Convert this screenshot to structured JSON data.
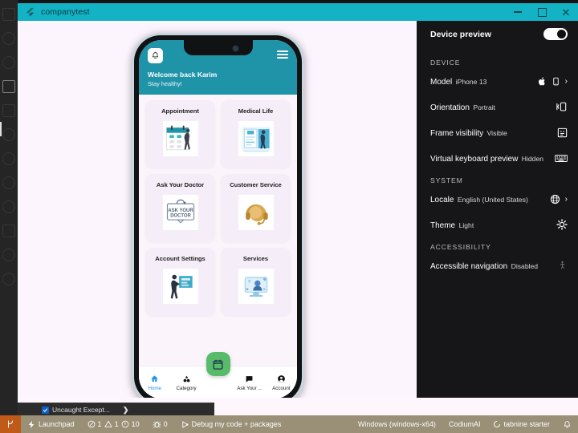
{
  "window": {
    "title": "companytest",
    "icon": "flutter-icon",
    "controls": {
      "minimize": "–",
      "maximize": "□",
      "close": "✕"
    }
  },
  "phone_app": {
    "header": {
      "bell_icon": "bell-icon",
      "menu_icon": "hamburger-menu-icon",
      "welcome": "Welcome back Karim",
      "subtitle": "Stay healthy!"
    },
    "cards": [
      {
        "label": "Appointment",
        "art": "calendar-illustration"
      },
      {
        "label": "Medical Life",
        "art": "medical-records-illustration"
      },
      {
        "label": "Ask Your Doctor",
        "art": "ask-your-doctor-illustration"
      },
      {
        "label": "Customer Service",
        "art": "headset-support-illustration"
      },
      {
        "label": "Account Settings",
        "art": "account-settings-illustration"
      },
      {
        "label": "Services",
        "art": "services-illustration"
      }
    ],
    "fab": {
      "icon": "calendar-icon",
      "color": "#57bb6a"
    },
    "bottom_nav": [
      {
        "label": "Home",
        "icon": "home-icon",
        "active": true
      },
      {
        "label": "Category",
        "icon": "category-icon",
        "active": false
      },
      {
        "label": "Ask Your ...",
        "icon": "chat-icon",
        "active": false
      },
      {
        "label": "Account",
        "icon": "account-icon",
        "active": false
      }
    ]
  },
  "device_preview": {
    "title": "Device preview",
    "toggle_on": true,
    "sections": [
      {
        "name": "DEVICE",
        "rows": [
          {
            "label": "Model",
            "value": "iPhone 13",
            "icons": [
              "apple-icon",
              "phone-icon"
            ],
            "chevron": true
          },
          {
            "label": "Orientation",
            "value": "Portrait",
            "icons": [
              "rotate-device-icon"
            ],
            "chevron": false
          },
          {
            "label": "Frame visibility",
            "value": "Visible",
            "icons": [
              "frame-icon"
            ],
            "chevron": false
          },
          {
            "label": "Virtual keyboard preview",
            "value": "Hidden",
            "icons": [
              "keyboard-icon"
            ],
            "chevron": false
          }
        ]
      },
      {
        "name": "SYSTEM",
        "rows": [
          {
            "label": "Locale",
            "value": "English (United States)",
            "icons": [
              "globe-icon"
            ],
            "chevron": true
          },
          {
            "label": "Theme",
            "value": "Light",
            "icons": [
              "brightness-icon"
            ],
            "chevron": false
          }
        ]
      },
      {
        "name": "ACCESSIBILITY",
        "rows": [
          {
            "label": "Accessible navigation",
            "value": "Disabled",
            "icons": [
              "accessibility-icon"
            ],
            "chevron": false
          }
        ]
      }
    ]
  },
  "exception_bar": {
    "checkbox_checked": true,
    "label": "Uncaught Except...",
    "expand": "❯"
  },
  "status_bar": {
    "vcs_icon": "branch-icon",
    "left": [
      {
        "label": "Launchpad",
        "icon": "launchpad-icon"
      },
      {
        "label": "1",
        "icon": "error-icon"
      },
      {
        "label": "1",
        "icon": "warning-icon"
      },
      {
        "label": "10",
        "icon": "info-icon"
      },
      {
        "label": "0",
        "icon": "bug-icon"
      },
      {
        "label": "Debug my code + packages",
        "icon": "debug-icon"
      }
    ],
    "right": [
      {
        "label": "Windows (windows-x64)",
        "icon": ""
      },
      {
        "label": "CodiumAI",
        "icon": ""
      },
      {
        "label": "tabnine starter",
        "icon": "tabnine-icon"
      },
      {
        "label": "",
        "icon": "notification-bell-icon"
      }
    ]
  },
  "colors": {
    "title_bar": "#13b2c4",
    "app_header": "#1f93a8",
    "fab_green": "#57bb6a",
    "nav_active": "#2196f3",
    "status_bar": "#9a8f77"
  }
}
